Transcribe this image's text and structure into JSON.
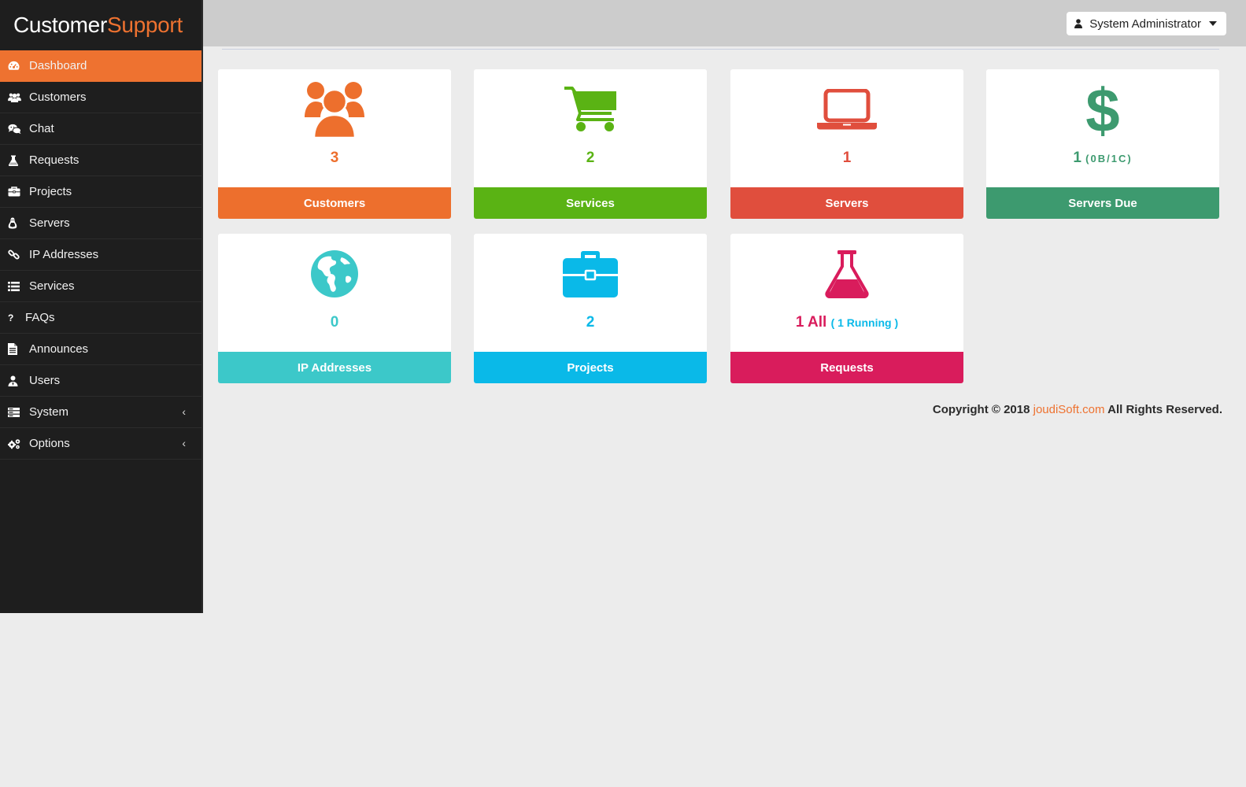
{
  "brand": {
    "part1": "Customer",
    "part2": "Support"
  },
  "colors": {
    "accent": "#ee7230",
    "sidebar": "#1e1e1e",
    "customers": "#ed6f2d",
    "services": "#5ab314",
    "servers": "#e04e3d",
    "servers_due": "#3d9a6f",
    "ip_addresses": "#3cc8c9",
    "projects": "#0ab9e8",
    "requests": "#d91c5c"
  },
  "sidebar": {
    "items": [
      {
        "label": "Dashboard",
        "icon": "dashboard-icon",
        "active": true
      },
      {
        "label": "Customers",
        "icon": "users-icon"
      },
      {
        "label": "Chat",
        "icon": "chat-icon"
      },
      {
        "label": "Requests",
        "icon": "flask-icon"
      },
      {
        "label": "Projects",
        "icon": "briefcase-icon"
      },
      {
        "label": "Servers",
        "icon": "linux-icon"
      },
      {
        "label": "IP Addresses",
        "icon": "link-icon"
      },
      {
        "label": "Services",
        "icon": "list-icon"
      },
      {
        "label": "FAQs",
        "icon": "question-icon"
      },
      {
        "label": "Announces",
        "icon": "document-icon"
      },
      {
        "label": "Users",
        "icon": "user-tie-icon"
      },
      {
        "label": "System",
        "icon": "server-icon",
        "chevron": "‹"
      },
      {
        "label": "Options",
        "icon": "gears-icon",
        "chevron": "‹"
      }
    ]
  },
  "header": {
    "user_label": "System Administrator"
  },
  "cards": {
    "customers": {
      "value": "3",
      "label": "Customers",
      "icon": "users-icon"
    },
    "services": {
      "value": "2",
      "label": "Services",
      "icon": "cart-icon"
    },
    "servers": {
      "value": "1",
      "label": "Servers",
      "icon": "laptop-icon"
    },
    "servers_due": {
      "value": "1",
      "sub": "(0B/1C)",
      "label": "Servers Due",
      "icon": "dollar-icon"
    },
    "ip_addresses": {
      "value": "0",
      "label": "IP Addresses",
      "icon": "globe-icon"
    },
    "projects": {
      "value": "2",
      "label": "Projects",
      "icon": "briefcase-icon"
    },
    "requests": {
      "value": "1 All",
      "sub": "( 1 Running )",
      "label": "Requests",
      "icon": "flask-icon"
    }
  },
  "footer": {
    "prefix": "Copyright © 2018 ",
    "link": "joudiSoft.com",
    "suffix": " All Rights Reserved."
  }
}
